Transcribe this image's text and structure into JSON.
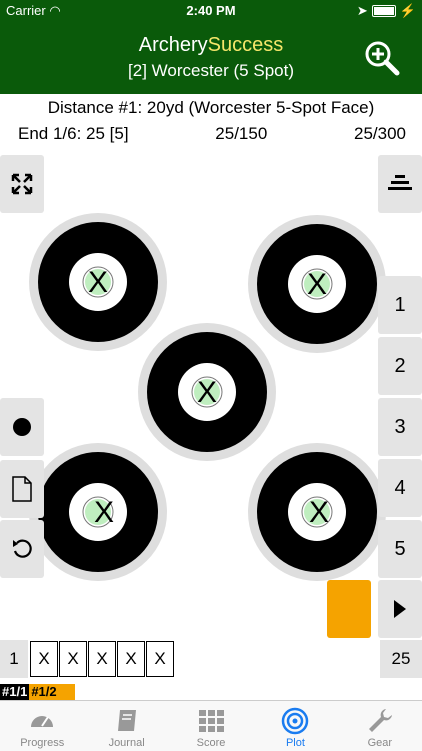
{
  "status": {
    "carrier": "Carrier",
    "time": "2:40 PM"
  },
  "header": {
    "title_main": "Archery",
    "title_accent": "Success",
    "subtitle": "[2] Worcester (5 Spot)"
  },
  "info": {
    "distance": "Distance #1: 20yd (Worcester 5-Spot Face)",
    "end": "End 1/6: 25 [5]",
    "score_a": "25/150",
    "score_b": "25/300"
  },
  "right_buttons": [
    "1",
    "2",
    "3",
    "4",
    "5"
  ],
  "arrow_marks": [
    "X",
    "X",
    "X",
    "X",
    "X"
  ],
  "end_row": {
    "end_number": "1",
    "arrows": [
      "X",
      "X",
      "X",
      "X",
      "X"
    ],
    "total": "25"
  },
  "selectors": {
    "first": "#1/1",
    "second": "#1/2"
  },
  "colors": {
    "header_green": "#0a5a0a",
    "accent_yellow": "#f5e66a",
    "orange": "#f5a300",
    "active_blue": "#1a7cf0"
  },
  "tabs": [
    {
      "label": "Progress",
      "icon": "gauge-icon"
    },
    {
      "label": "Journal",
      "icon": "book-icon"
    },
    {
      "label": "Score",
      "icon": "grid-icon"
    },
    {
      "label": "Plot",
      "icon": "target-icon"
    },
    {
      "label": "Gear",
      "icon": "wrench-icon"
    }
  ]
}
